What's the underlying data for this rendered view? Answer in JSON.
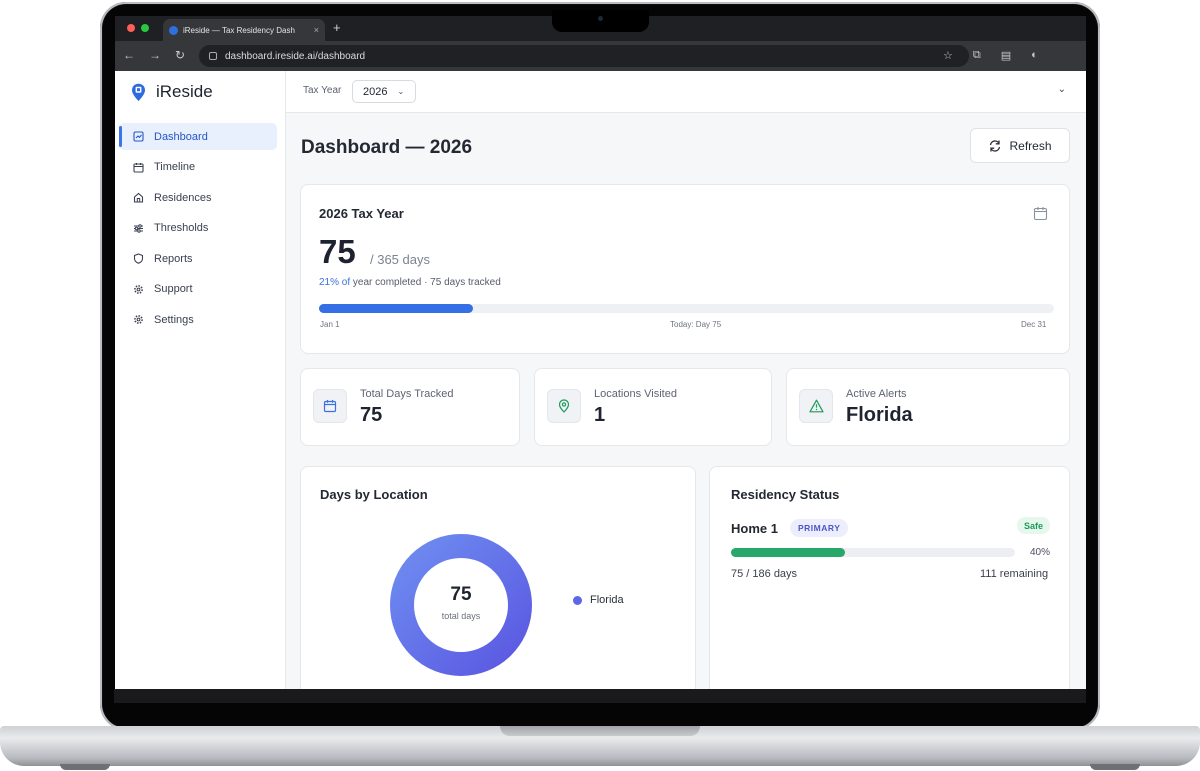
{
  "browser": {
    "tab_title": "iReside — Tax Residency Dash",
    "tab_close": "×",
    "new_tab": "+",
    "url": "dashboard.ireside.ai/dashboard"
  },
  "app": {
    "name": "iReside",
    "accent": "#3470e3"
  },
  "sidebar": {
    "items": [
      {
        "label": "Dashboard",
        "icon": "dashboard-icon",
        "active": true
      },
      {
        "label": "Timeline",
        "icon": "calendar-icon",
        "active": false
      },
      {
        "label": "Residences",
        "icon": "home-icon",
        "active": false
      },
      {
        "label": "Thresholds",
        "icon": "sliders-icon",
        "active": false
      },
      {
        "label": "Reports",
        "icon": "shield-icon",
        "active": false
      },
      {
        "label": "Support",
        "icon": "gear-icon",
        "active": false
      },
      {
        "label": "Settings",
        "icon": "gear-icon",
        "active": false
      }
    ]
  },
  "topbar": {
    "tax_year_label": "Tax Year",
    "tax_year_value": "2026"
  },
  "main": {
    "title": "Dashboard — 2026",
    "refresh_label": "Refresh"
  },
  "year_card": {
    "title": "2026 Tax Year",
    "days_count": "75",
    "days_total": "/ 365 days",
    "pct_text": "21% of",
    "note_text": " year completed · 75 days tracked",
    "progress": 0.21,
    "start_label": "Jan 1",
    "today_label": "Today: Day 75",
    "end_label": "Dec 31"
  },
  "stats": [
    {
      "label": "Total Days Tracked",
      "value": "75",
      "icon": "calendar-icon"
    },
    {
      "label": "Locations Visited",
      "value": "1",
      "icon": "location-pin-icon"
    },
    {
      "label": "Active Alerts",
      "value": "Florida",
      "icon": "warning-icon"
    }
  ],
  "days_by_location": {
    "title": "Days by Location",
    "center_value": "75",
    "center_label": "total days",
    "legend": [
      {
        "name": "Florida",
        "color": "#5b67e6"
      }
    ]
  },
  "residency_status": {
    "title": "Residency Status",
    "home_name": "Home 1",
    "home_badge": "PRIMARY",
    "status_badge": "Safe",
    "progress": 0.4,
    "pct_text": "40%",
    "days_text": "75 / 186 days",
    "remaining_text": "111 remaining"
  }
}
